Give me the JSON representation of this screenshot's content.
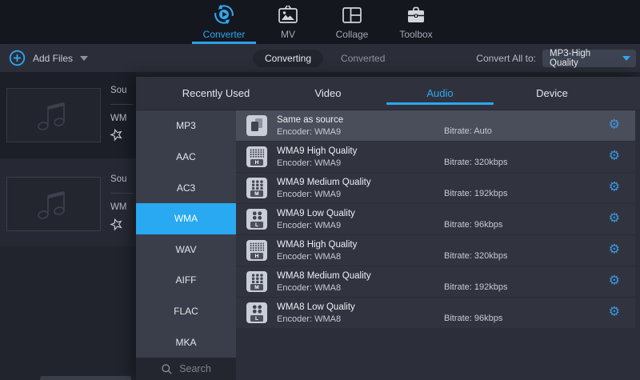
{
  "colors": {
    "accent": "#2ea7f2",
    "selected_blue": "#29a9f1",
    "gear_blue": "#3e97e2",
    "panel_bg": "#2c2f39"
  },
  "nav": {
    "items": [
      {
        "label": "Converter",
        "icon": "converter-icon",
        "active": true
      },
      {
        "label": "MV",
        "icon": "mv-icon",
        "active": false
      },
      {
        "label": "Collage",
        "icon": "collage-icon",
        "active": false
      },
      {
        "label": "Toolbox",
        "icon": "toolbox-icon",
        "active": false
      }
    ]
  },
  "toolbar": {
    "add_files_label": "Add Files",
    "view_tabs": [
      {
        "label": "Converting",
        "active": true
      },
      {
        "label": "Converted",
        "active": false
      }
    ],
    "convert_all_label": "Convert All to:",
    "convert_all_value": "MP3-High Quality"
  },
  "source_list": {
    "items": [
      {
        "name": "Sou",
        "format": "WM"
      },
      {
        "name": "Sou",
        "format": "WM"
      }
    ]
  },
  "format_panel": {
    "tabs": [
      {
        "label": "Recently Used",
        "active": false
      },
      {
        "label": "Video",
        "active": false
      },
      {
        "label": "Audio",
        "active": true
      },
      {
        "label": "Device",
        "active": false
      }
    ],
    "sidebar_formats": [
      {
        "label": "MP3",
        "selected": false
      },
      {
        "label": "AAC",
        "selected": false
      },
      {
        "label": "AC3",
        "selected": false
      },
      {
        "label": "WMA",
        "selected": true
      },
      {
        "label": "WAV",
        "selected": false
      },
      {
        "label": "AIFF",
        "selected": false
      },
      {
        "label": "FLAC",
        "selected": false
      },
      {
        "label": "MKA",
        "selected": false
      }
    ],
    "search_placeholder": "Search",
    "profiles": [
      {
        "title": "Same as source",
        "encoder": "Encoder: WMA9",
        "bitrate": "Bitrate: Auto",
        "badge": "",
        "icon": "same-as-source",
        "highlighted": true
      },
      {
        "title": "WMA9 High Quality",
        "encoder": "Encoder: WMA9",
        "bitrate": "Bitrate: 320kbps",
        "badge": "H",
        "icon": "grid-high",
        "highlighted": false
      },
      {
        "title": "WMA9 Medium Quality",
        "encoder": "Encoder: WMA9",
        "bitrate": "Bitrate: 192kbps",
        "badge": "M",
        "icon": "grid-medium",
        "highlighted": false
      },
      {
        "title": "WMA9 Low Quality",
        "encoder": "Encoder: WMA9",
        "bitrate": "Bitrate: 96kbps",
        "badge": "L",
        "icon": "grid-low",
        "highlighted": false
      },
      {
        "title": "WMA8 High Quality",
        "encoder": "Encoder: WMA8",
        "bitrate": "Bitrate: 320kbps",
        "badge": "H",
        "icon": "grid-high",
        "highlighted": false
      },
      {
        "title": "WMA8 Medium Quality",
        "encoder": "Encoder: WMA8",
        "bitrate": "Bitrate: 192kbps",
        "badge": "M",
        "icon": "grid-medium",
        "highlighted": false
      },
      {
        "title": "WMA8 Low Quality",
        "encoder": "Encoder: WMA8",
        "bitrate": "Bitrate: 96kbps",
        "badge": "L",
        "icon": "grid-low",
        "highlighted": false
      }
    ]
  },
  "icons": {
    "gear": "⚙"
  }
}
